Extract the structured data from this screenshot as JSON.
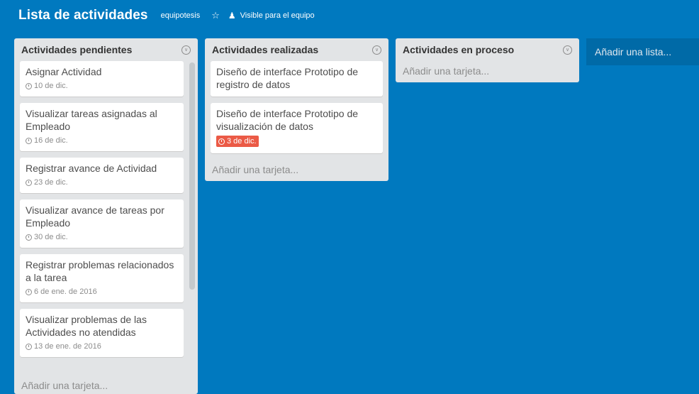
{
  "board": {
    "title": "Lista de actividades",
    "team": "equipotesis",
    "star_icon": "star-icon",
    "visibility_icon": "team-icon",
    "visibility": "Visible para el equipo"
  },
  "lists": [
    {
      "title": "Actividades pendientes",
      "add_card": "Añadir una tarjeta...",
      "cards": [
        {
          "title": "Asignar Actividad",
          "due": "10 de dic."
        },
        {
          "title": "Visualizar tareas asignadas al Empleado",
          "due": "16 de dic."
        },
        {
          "title": "Registrar avance de Actividad",
          "due": "23 de dic."
        },
        {
          "title": "Visualizar avance de tareas por Empleado",
          "due": "30 de dic."
        },
        {
          "title": "Registrar problemas relacionados a la tarea",
          "due": "6 de ene. de 2016"
        },
        {
          "title": "Visualizar problemas de las Actividades no atendidas",
          "due": "13 de ene. de 2016"
        }
      ]
    },
    {
      "title": "Actividades realizadas",
      "add_card": "Añadir una tarjeta...",
      "cards": [
        {
          "title": "Diseño de interface Prototipo de registro de datos"
        },
        {
          "title": "Diseño de interface Prototipo de visualización de datos",
          "due": "3 de dic."
        }
      ]
    },
    {
      "title": "Actividades en proceso",
      "add_card": "Añadir una tarjeta...",
      "cards": []
    }
  ],
  "add_list": "Añadir una lista...",
  "colors": {
    "board": "#0079bf",
    "list": "#e2e4e6",
    "overdue": "#eb5a46"
  }
}
